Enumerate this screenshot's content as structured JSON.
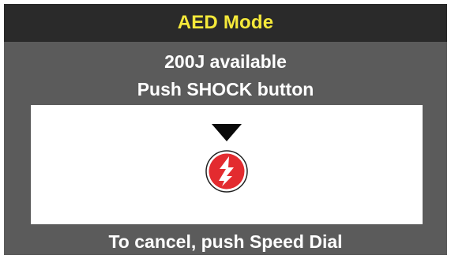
{
  "title": "AED Mode",
  "message": {
    "line1": "200J available",
    "line2": "Push SHOCK button"
  },
  "footer": "To cancel, push Speed Dial",
  "icons": {
    "pointer": "down-triangle-icon",
    "shock": "shock-button-icon"
  },
  "colors": {
    "title_text": "#f5e93a",
    "title_bar": "#2a2a2a",
    "background": "#5b5b5b",
    "panel": "#ffffff",
    "shock_red": "#e32b2f"
  }
}
